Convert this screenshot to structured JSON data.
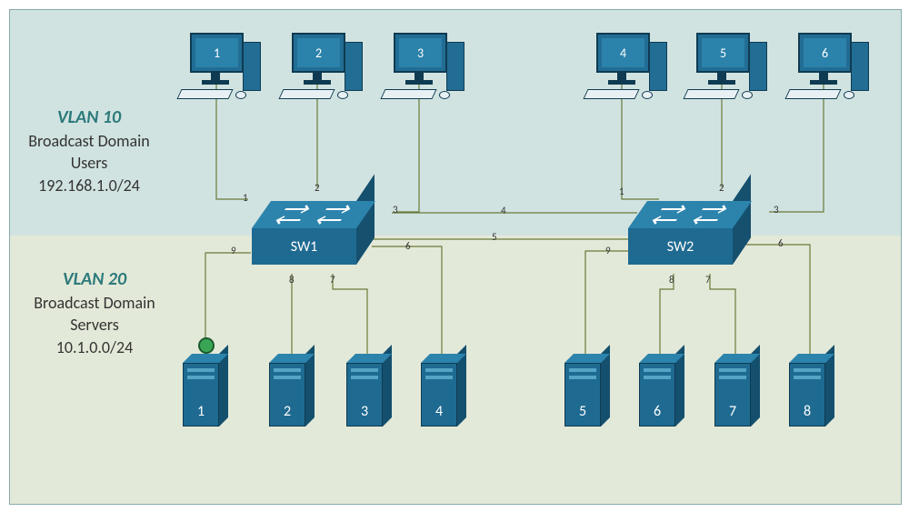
{
  "vlan10": {
    "name": "VLAN 10",
    "line2": "Broadcast Domain",
    "line3": "Users",
    "subnet": "192.168.1.0/24"
  },
  "vlan20": {
    "name": "VLAN 20",
    "line2": "Broadcast Domain",
    "line3": "Servers",
    "subnet": "10.1.0.0/24"
  },
  "pcs": [
    "1",
    "2",
    "3",
    "4",
    "5",
    "6"
  ],
  "servers": [
    "1",
    "2",
    "3",
    "4",
    "5",
    "6",
    "7",
    "8"
  ],
  "switches": {
    "sw1": "SW1",
    "sw2": "SW2"
  },
  "ports": {
    "sw1": {
      "p1": "1",
      "p2": "2",
      "p3": "3",
      "p4": "4",
      "p5": "5",
      "p6": "6",
      "p7": "7",
      "p8": "8",
      "p9": "9"
    },
    "sw2": {
      "p1": "1",
      "p2": "2",
      "p3": "3",
      "p6": "6",
      "p7": "7",
      "p8": "8",
      "p9": "9"
    }
  },
  "colors": {
    "device": "#226d94",
    "deviceDark": "#15506e",
    "vlan10bg": "#d1e3e1",
    "vlan20bg": "#e3e9d8",
    "wire": "#6a7a3a"
  }
}
